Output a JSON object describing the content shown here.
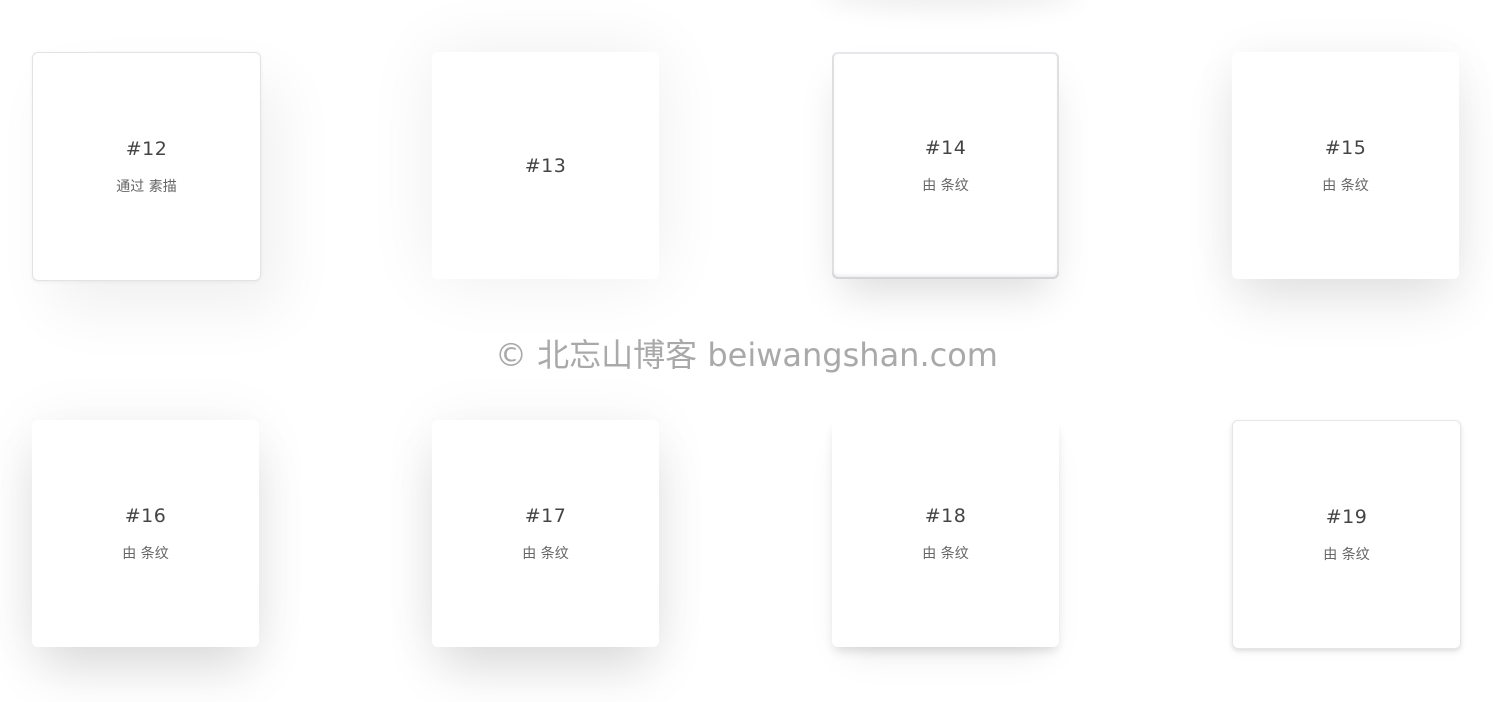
{
  "cards": [
    {
      "title": "#12",
      "subtitle": "通过 素描"
    },
    {
      "title": "#13",
      "subtitle": ""
    },
    {
      "title": "#14",
      "subtitle": "由 条纹"
    },
    {
      "title": "#15",
      "subtitle": "由 条纹"
    },
    {
      "title": "#16",
      "subtitle": "由 条纹"
    },
    {
      "title": "#17",
      "subtitle": "由 条纹"
    },
    {
      "title": "#18",
      "subtitle": "由 条纹"
    },
    {
      "title": "#19",
      "subtitle": "由 条纹"
    }
  ],
  "watermark": "© 北忘山博客 beiwangshan.com",
  "colors": {
    "background": "#ffffff",
    "card": "#ffffff",
    "title_text": "#444444",
    "subtitle_text": "#666666",
    "watermark_text": "#a9a9a9"
  }
}
